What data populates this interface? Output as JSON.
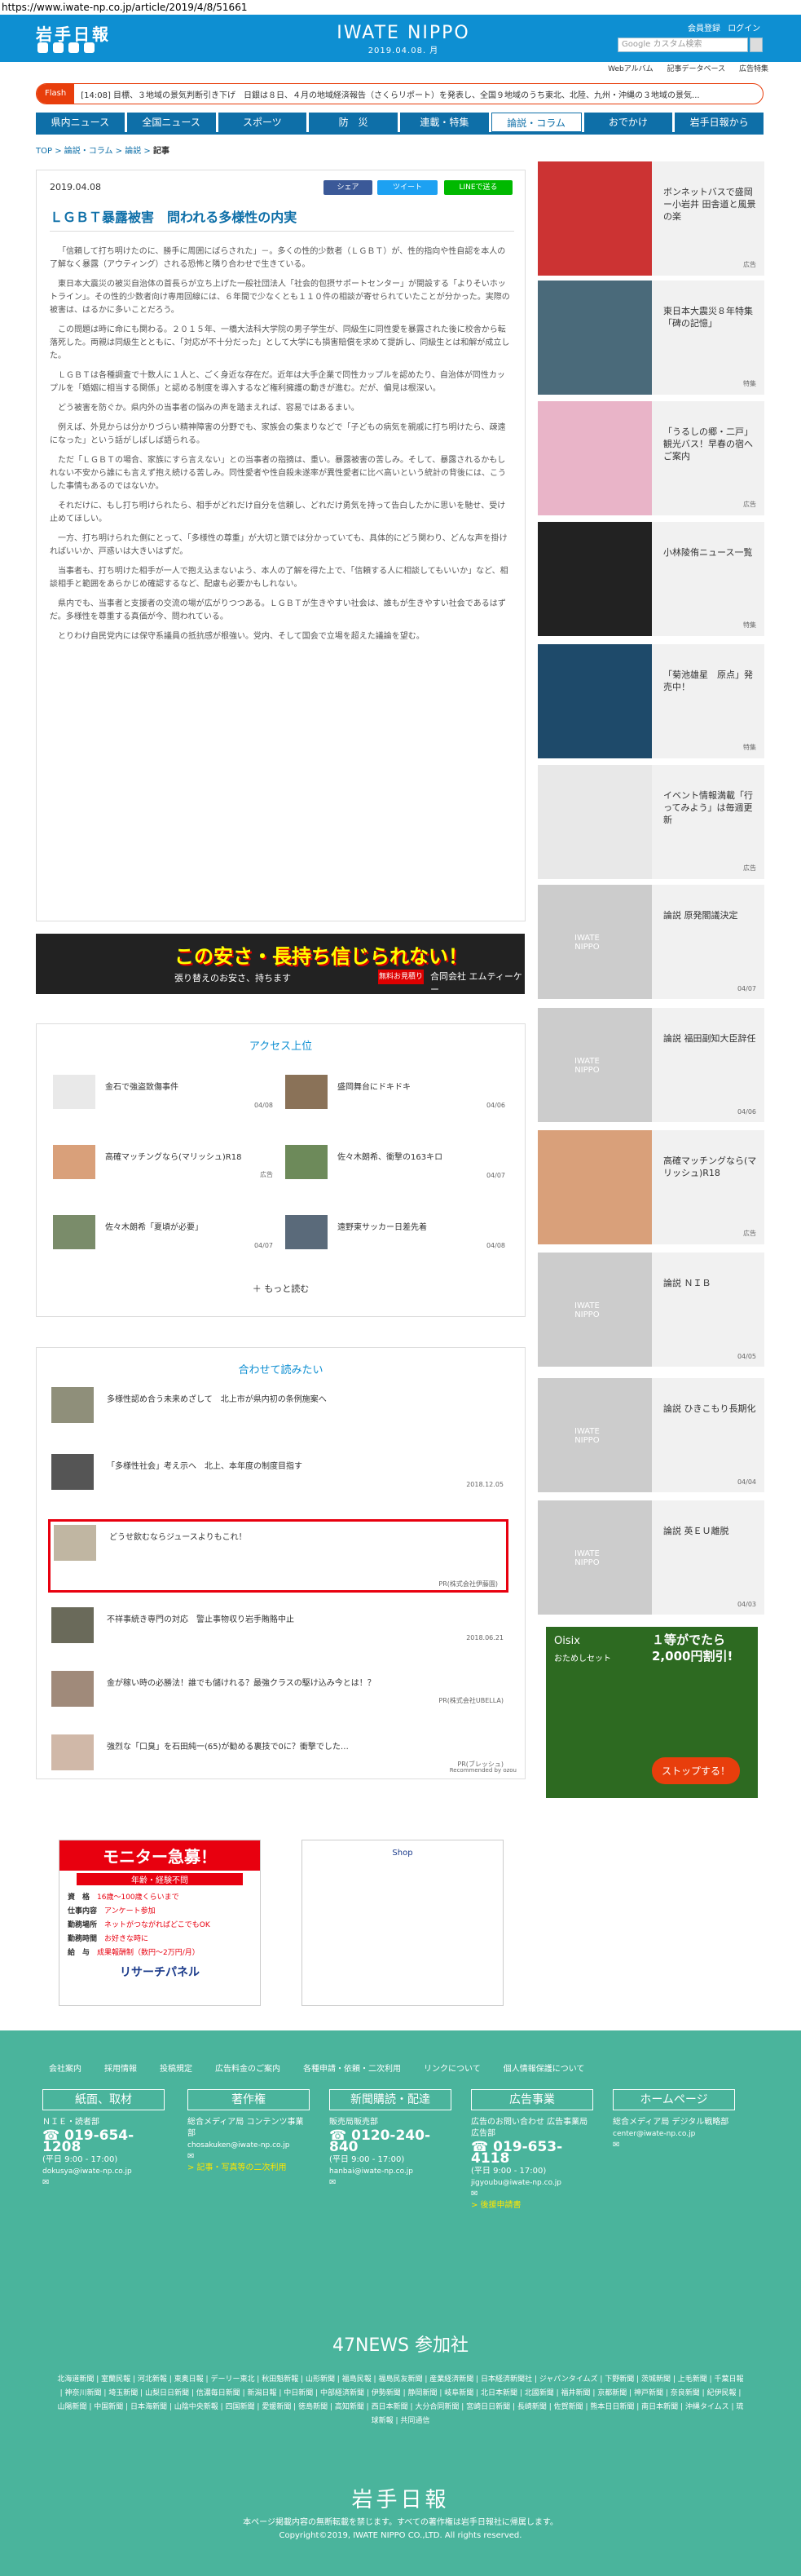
{
  "url": "https://www.iwate-np.co.jp/article/2019/4/8/51661",
  "header": {
    "logo": "岩手日報",
    "center_title": "IWATE NIPPO",
    "center_date": "2019.04.08. 月",
    "account_links": [
      "会員登録",
      "ログイン"
    ],
    "search_placeholder": "Google カスタム検索",
    "sub_links": [
      "Webアルバム",
      "記事データベース",
      "広告特集"
    ]
  },
  "flash": {
    "label": "Flash",
    "text": "[14:08] 目標、３地域の景気判断引き下げ　日銀は８日、４月の地域経済報告（さくらリポート）を発表し、全国９地域のうち東北、北陸、九州・沖縄の３地域の景気..."
  },
  "nav": [
    "県内ニュース",
    "全国ニュース",
    "スポーツ",
    "防　災",
    "連載・特集",
    "論説・コラム",
    "おでかけ",
    "岩手日報から"
  ],
  "breadcrumb": [
    "TOP",
    "論説・コラム",
    "論説",
    "記事"
  ],
  "article": {
    "date": "2019.04.08",
    "share": [
      "シェア",
      "ツイート",
      "LINEで送る"
    ],
    "title": "ＬＧＢＴ暴露被害　問われる多様性の内実",
    "paragraphs": [
      "「信頼して打ち明けたのに、勝手に周囲にばらされた」－。多くの性的少数者（ＬＧＢＴ）が、性的指向や性自認を本人の了解なく暴露（アウティング）される恐怖と隣り合わせで生きている。",
      "東日本大震災の被災自治体の首長らが立ち上げた一般社団法人「社会的包摂サポートセンター」が開設する「よりそいホットライン」。その性的少数者向け専用回線には、６年間で少なくとも１１０件の相談が寄せられていたことが分かった。実際の被害は、はるかに多いことだろう。",
      "この問題は時に命にも関わる。２０１５年、一橋大法科大学院の男子学生が、同級生に同性愛を暴露された後に校舎から転落死した。両親は同級生とともに、「対応が不十分だった」として大学にも損害賠償を求めて提訴し、同級生とは和解が成立した。",
      "ＬＧＢＴは各種調査で十数人に１人と、ごく身近な存在だ。近年は大手企業で同性カップルを認めたり、自治体が同性カップルを「婚姻に相当する関係」と認める制度を導入するなど権利擁護の動きが進む。だが、偏見は根深い。",
      "どう被害を防ぐか。県内外の当事者の悩みの声を踏まえれば、容易ではあるまい。",
      "例えば、外見からは分かりづらい精神障害の分野でも、家族会の集まりなどで「子どもの病気を親戚に打ち明けたら、疎遠になった」という話がしばしば語られる。",
      "ただ「ＬＧＢＴの場合、家族にすら言えない」との当事者の指摘は、重い。暴露被害の苦しみ。そして、暴露されるかもしれない不安から誰にも言えず抱え続ける苦しみ。同性愛者や性自殺未遂率が異性愛者に比べ高いという統計の背後には、こうした事情もあるのではないか。",
      "それだけに、もし打ち明けられたら、相手がどれだけ自分を信頼し、どれだけ勇気を持って告白したかに思いを馳せ、受け止めてほしい。",
      "一方、打ち明けられた側にとって、「多様性の尊重」が大切と頭では分かっていても、具体的にどう関わり、どんな声を掛ければいいか、戸惑いは大きいはずだ。",
      "当事者も、打ち明けた相手が一人で抱え込まないよう、本人の了解を得た上で、「信頼する人に相談してもいいか」など、相談相手と範囲をあらかじめ確認するなど、配慮も必要かもしれない。",
      "県内でも、当事者と支援者の交流の場が広がりつつある。ＬＧＢＴが生きやすい社会は、誰もが生きやすい社会であるはずだ。多様性を尊重する真価が今、問われている。",
      "とりわけ自民党内には保守系議員の抵抗感が根強い。党内、そして国会で立場を超えた議論を望む。"
    ]
  },
  "banner": {
    "headline": "この安さ・長持ち信じられない！",
    "sub": "張り替えのお安さ、持ちます",
    "offer": "無料お見積り",
    "company": "合同会社 エムティーケー"
  },
  "access": {
    "title": "アクセス上位",
    "items": [
      {
        "text": "金石で強盗致傷事件",
        "date": "04/08"
      },
      {
        "text": "盛岡舞台にドキドキ",
        "date": "04/06"
      },
      {
        "text": "高確マッチングなら(マリッシュ)R18",
        "date": "広告"
      },
      {
        "text": "佐々木朗希、衝撃の163キロ",
        "date": "04/07"
      },
      {
        "text": "佐々木朗希「夏頃が必要」",
        "date": "04/07"
      },
      {
        "text": "遠野東サッカー日差先着",
        "date": "04/08"
      }
    ],
    "more": "もっと読む"
  },
  "related": {
    "title": "合わせて読みたい",
    "items": [
      {
        "text": "多様性認め合う未来めざして　北上市が県内初の条例施案へ",
        "date": ""
      },
      {
        "text": "「多様性社会」考え示へ　北上、本年度の制度目指す",
        "date": "2018.12.05"
      },
      {
        "text": "どうせ飲むならジュースよりもこれ！",
        "date": "PR(株式会社伊藤園)"
      },
      {
        "text": "不祥事続き専門の対応　警止事物収り岩手賄賂中止",
        "date": "2018.06.21"
      },
      {
        "text": "金が稼い時の必勝法！誰でも儲けれる？最強クラスの駆け込み今とは！？",
        "date": "PR(株式会社UBELLA)"
      },
      {
        "text": "強烈な「口臭」を石田純一(65)が勧める裏技で0に？衝撃でした…",
        "date": "PR(ブレッシュ)"
      }
    ],
    "credit": "Recommended by ozou"
  },
  "ad_left": {
    "headline": "モニター急募！",
    "sub": "年齢・経験不問",
    "rows": [
      [
        "資　格",
        "16歳〜100歳くらいまで"
      ],
      [
        "仕事内容",
        "アンケート参加"
      ],
      [
        "勤務場所",
        "ネットがつながればどこでもOK"
      ],
      [
        "勤務時間",
        "お好きな時に"
      ],
      [
        "給　与",
        "成果報酬制（数円〜2万円/月）"
      ]
    ],
    "brand": "リサーチパネル"
  },
  "ad_right": {
    "label": "Shop"
  },
  "sidebar": [
    {
      "text": "ボンネットバスで盛岡ー小岩井 田舎道と風景の楽",
      "tag": "広告"
    },
    {
      "text": "東日本大震災８年特集「碑の記憶」",
      "tag": "特集"
    },
    {
      "text": "「うるしの郷・二戸」観光バス！早春の宿へご案内",
      "tag": "広告"
    },
    {
      "text": "小林陵侑ニュース一覧",
      "tag": "特集"
    },
    {
      "text": "「菊池雄星　原点」発売中！",
      "tag": "特集"
    },
    {
      "text": "イベント情報満載「行ってみよう」は毎週更新",
      "tag": "広告"
    },
    {
      "text": "論説 原発閣議決定",
      "tag": "04/07"
    },
    {
      "text": "論説 福田副知大臣辞任",
      "tag": "04/06"
    },
    {
      "text": "高確マッチングなら(マリッシュ)R18",
      "tag": "広告"
    },
    {
      "text": "論説 ＮＩＢ",
      "tag": "04/05"
    },
    {
      "text": "論説 ひきこもり長期化",
      "tag": "04/04"
    },
    {
      "text": "論説 英ＥＵ離脱",
      "tag": "04/03"
    }
  ],
  "side_ad": {
    "brand": "Oisix",
    "sub": "おためしセット",
    "offer": "１等がでたら2,000円割引!",
    "cta": "ストップする！"
  },
  "footer": {
    "links": [
      "会社案内",
      "採用情報",
      "投稿規定",
      "広告料金のご案内",
      "各種申請・依頼・二次利用",
      "リンクについて",
      "個人情報保護について"
    ],
    "columns": [
      {
        "head": "紙面、取材",
        "sub1": "ＮＩＥ・読者部",
        "tel": "019-654-1208",
        "hours": "(平日 9:00 - 17:00)",
        "mail": "dokusya@iwate-np.co.jp",
        "extra": ""
      },
      {
        "head": "著作権",
        "sub1": "総合メディア局 コンテンツ事業部",
        "tel": "",
        "hours": "",
        "mail": "chosakuken@iwate-np.co.jp",
        "extra": "> 記事・写真等の二次利用"
      },
      {
        "head": "新聞購読・配達",
        "sub1": "販売局販売部",
        "tel": "0120-240-840",
        "hours": "(平日 9:00 - 17:00)",
        "mail": "hanbai@iwate-np.co.jp",
        "extra": ""
      },
      {
        "head": "広告事業",
        "sub1": "広告のお問い合わせ 広告事業局広告部",
        "tel": "019-653-4118",
        "hours": "(平日 9:00 - 17:00)",
        "mail": "jigyoubu@iwate-np.co.jp",
        "extra": "> 後援申請書"
      },
      {
        "head": "ホームページ",
        "sub1": "総合メディア局 デジタル戦略部",
        "tel": "",
        "hours": "",
        "mail": "center@iwate-np.co.jp",
        "extra": ""
      }
    ],
    "news_title": "47NEWS 参加社",
    "papers": "北海道新聞 | 室蘭民報 | 河北新報 | 東奥日報 | デーリー東北 | 秋田魁新報 | 山形新聞 | 福島民報 | 福島民友新聞 | 産業経済新聞 | 日本経済新聞社 | ジャパンタイムズ | 下野新聞 | 茨城新聞 | 上毛新聞 | 千葉日報 | 神奈川新聞 | 埼玉新聞 | 山梨日日新聞 | 信濃毎日新聞 | 新潟日報 | 中日新聞 | 中部経済新聞 | 伊勢新聞 | 静岡新聞 | 岐阜新聞 | 北日本新聞 | 北國新聞 | 福井新聞 | 京都新聞 | 神戸新聞 | 奈良新聞 | 紀伊民報 | 山陽新聞 | 中国新聞 | 日本海新聞 | 山陰中央新報 | 四国新聞 | 愛媛新聞 | 徳島新聞 | 高知新聞 | 西日本新聞 | 大分合同新聞 | 宮崎日日新聞 | 長崎新聞 | 佐賀新聞 | 熊本日日新聞 | 南日本新聞 | 沖縄タイムス | 琉球新報 | 共同通信",
    "logo": "岩手日報",
    "notice": "本ページ掲載内容の無断転載を禁じます。すべての著作権は岩手日報社に帰属します。",
    "copyright": "Copyright©2019, IWATE NIPPO CO.,LTD. All rights reserved."
  }
}
